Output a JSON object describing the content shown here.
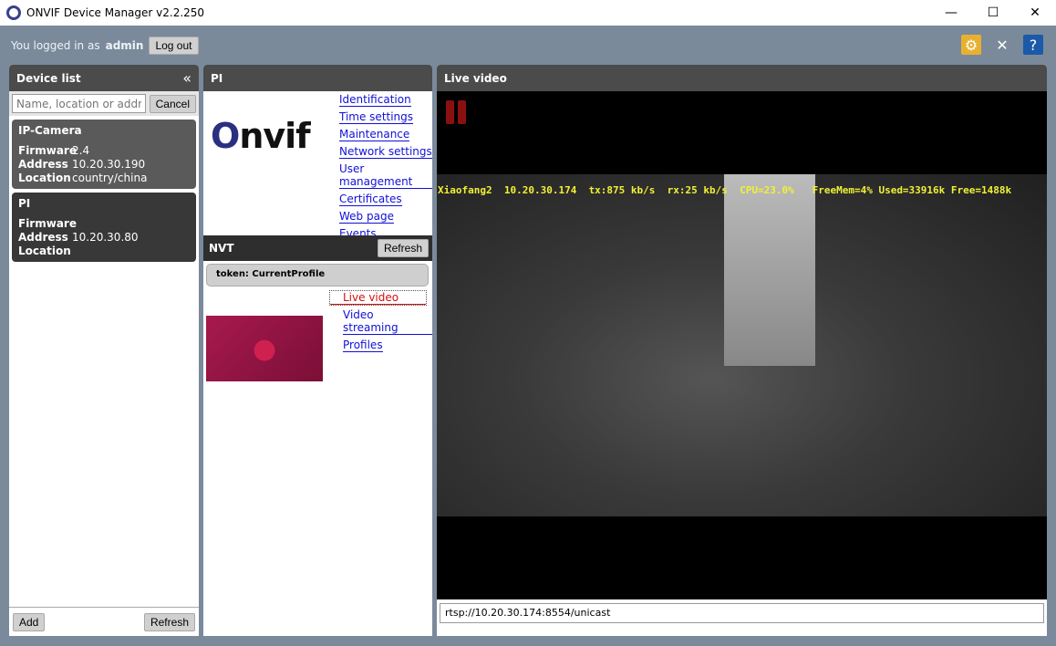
{
  "window": {
    "title": "ONVIF Device Manager v2.2.250",
    "minimize": "—",
    "maximize": "☐",
    "close": "✕"
  },
  "login": {
    "prefix": "You logged in as",
    "user": "admin",
    "logout": "Log out"
  },
  "device_list": {
    "title": "Device list",
    "collapse": "«",
    "search_placeholder": "Name, location or address",
    "cancel": "Cancel",
    "devices": [
      {
        "name": "IP-Camera",
        "firmware": "2.4",
        "address": "10.20.30.190",
        "location": "country/china"
      },
      {
        "name": "PI",
        "firmware": "",
        "address": "10.20.30.80",
        "location": ""
      }
    ],
    "labels": {
      "firmware": "Firmware",
      "address": "Address",
      "location": "Location"
    },
    "add": "Add",
    "refresh": "Refresh"
  },
  "device": {
    "title": "PI",
    "logo": "ONVIF",
    "links": [
      "Identification",
      "Time settings",
      "Maintenance",
      "Network settings",
      "User management",
      "Certificates",
      "Web page",
      "Events"
    ],
    "nvt": {
      "title": "NVT",
      "refresh": "Refresh",
      "token": "token: CurrentProfile",
      "links": [
        "Live video",
        "Video streaming",
        "Profiles"
      ]
    }
  },
  "live": {
    "title": "Live video",
    "osd": "Xiaofang2  10.20.30.174  tx:875 kb/s  rx:25 kb/s  CPU=23.0%   FreeMem=4% Used=33916k Free=1488k",
    "url": "rtsp://10.20.30.174:8554/unicast"
  }
}
